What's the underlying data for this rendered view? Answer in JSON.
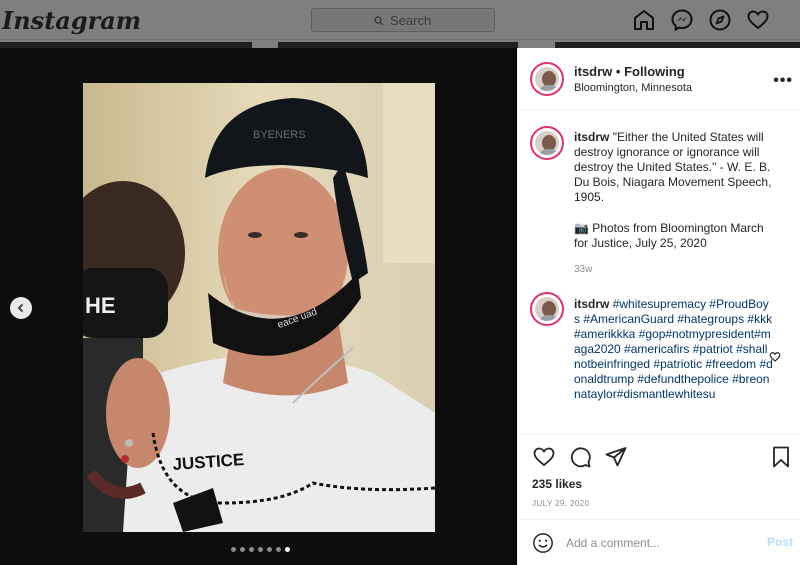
{
  "app": {
    "logo": "Instagram"
  },
  "search": {
    "placeholder": "Search"
  },
  "nav": {
    "icons": [
      "home-icon",
      "messenger-icon",
      "explore-icon",
      "heart-icon"
    ]
  },
  "post": {
    "username": "itsdrw",
    "follow_status": "• Following",
    "location": "Bloomington, Minnesota",
    "caption": "\"Either the United States will destroy ignorance or ignorance will destroy the United States.\" - W. E. B. Du Bois, Niagara Movement Speech, 1905.",
    "caption_extra": "📷 Photos from Bloomington March for Justice, July 25, 2020",
    "caption_time": "33w",
    "comment_user": "itsdrw",
    "comment_text": "#whitesupremacy #ProudBoys #AmericanGuard #hategroups #kkk #amerikkka #gop#notmypresident#maga2020 #americafirs #patriot #shallnotbeinfringed #patriotic #freedom #donaldtrump #defundthepolice #breonnataylor#dismantlewhitesu",
    "likes": "235 likes",
    "date": "JULY 29, 2020",
    "carousel": {
      "count": 7,
      "active_index": 6
    },
    "photo_text": {
      "cap": "BYENERS",
      "mask": "eace uad",
      "shirt": "JUSTICE"
    }
  },
  "add_comment": {
    "placeholder": "Add a comment...",
    "post_label": "Post"
  },
  "colors": {
    "link": "#00376b",
    "muted": "#8e8e8e",
    "story_ring": "#e1306c",
    "post_btn": "#b2dffc"
  }
}
